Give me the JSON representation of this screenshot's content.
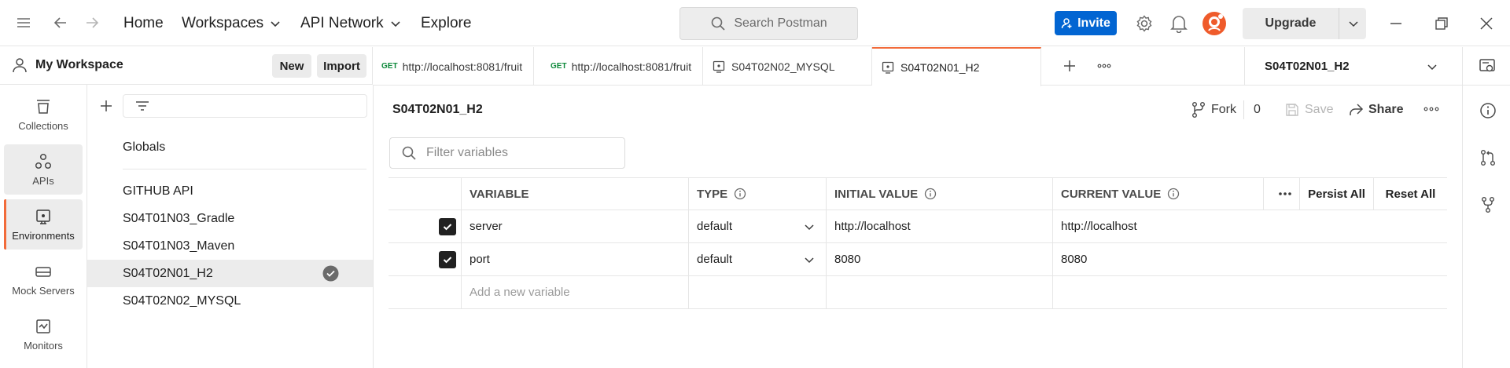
{
  "topbar": {
    "menu_icon": "hamburger-icon",
    "nav": {
      "home": "Home",
      "workspaces": "Workspaces",
      "api_network": "API Network",
      "explore": "Explore"
    },
    "search_placeholder": "Search Postman",
    "invite_label": "Invite",
    "upgrade_label": "Upgrade"
  },
  "workspace": {
    "name": "My Workspace",
    "new_label": "New",
    "import_label": "Import"
  },
  "rail": {
    "items": [
      {
        "label": "Collections",
        "icon": "collections-icon"
      },
      {
        "label": "APIs",
        "icon": "apis-icon"
      },
      {
        "label": "Environments",
        "icon": "environments-icon"
      },
      {
        "label": "Mock Servers",
        "icon": "mock-servers-icon"
      },
      {
        "label": "Monitors",
        "icon": "monitors-icon"
      }
    ]
  },
  "environments": {
    "globals": "Globals",
    "items": [
      {
        "name": "GITHUB API"
      },
      {
        "name": "S04T01N03_Gradle"
      },
      {
        "name": "S04T01N03_Maven"
      },
      {
        "name": "S04T02N01_H2"
      },
      {
        "name": "S04T02N02_MYSQL"
      }
    ]
  },
  "tabs": [
    {
      "method": "GET",
      "label": "http://localhost:8081/fruit"
    },
    {
      "method": "GET",
      "label": "http://localhost:8081/fruit"
    },
    {
      "method": "",
      "label": "S04T02N02_MYSQL"
    },
    {
      "method": "",
      "label": "S04T02N01_H2"
    }
  ],
  "env_selector": {
    "selected": "S04T02N01_H2"
  },
  "main": {
    "title": "S04T02N01_H2",
    "fork_label": "Fork",
    "fork_count": "0",
    "save_label": "Save",
    "share_label": "Share",
    "filter_placeholder": "Filter variables"
  },
  "table": {
    "headers": {
      "variable": "VARIABLE",
      "type": "TYPE",
      "initial": "INITIAL VALUE",
      "current": "CURRENT VALUE",
      "persist_all": "Persist All",
      "reset_all": "Reset All"
    },
    "rows": [
      {
        "checked": true,
        "variable": "server",
        "type": "default",
        "initial": "http://localhost",
        "current": "http://localhost"
      },
      {
        "checked": true,
        "variable": "port",
        "type": "default",
        "initial": "8080",
        "current": "8080"
      }
    ],
    "add_placeholder": "Add a new variable"
  },
  "colors": {
    "accent": "#f26b3a",
    "invite_blue": "#0265d2",
    "get_green": "#0f8a3c"
  }
}
